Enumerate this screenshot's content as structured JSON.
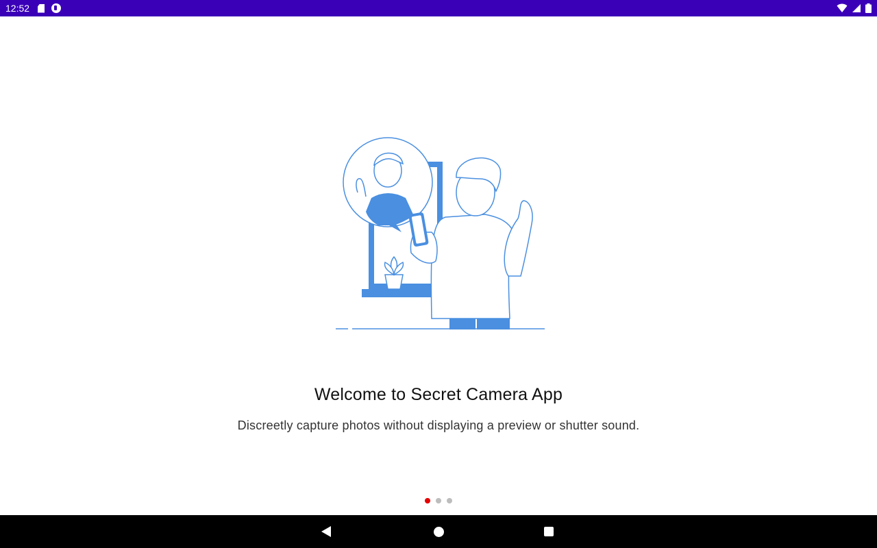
{
  "status_bar": {
    "time": "12:52",
    "left_icons": [
      "sd-card-icon",
      "app-notification-icon"
    ],
    "right_icons": [
      "wifi-icon",
      "cell-signal-icon",
      "battery-icon"
    ],
    "background": "#3a00b8"
  },
  "onboarding": {
    "illustration": "person-video-call-illustration",
    "title": "Welcome to Secret Camera App",
    "subtitle": "Discreetly capture photos without displaying a preview or shutter sound.",
    "page_indicator": {
      "pages": 3,
      "active_index": 0,
      "active_color": "#e60000",
      "inactive_color": "#bdbdbd"
    },
    "accent_color": "#4a8fe0"
  },
  "nav_bar": {
    "buttons": [
      "back-icon",
      "home-icon",
      "recents-icon"
    ]
  }
}
